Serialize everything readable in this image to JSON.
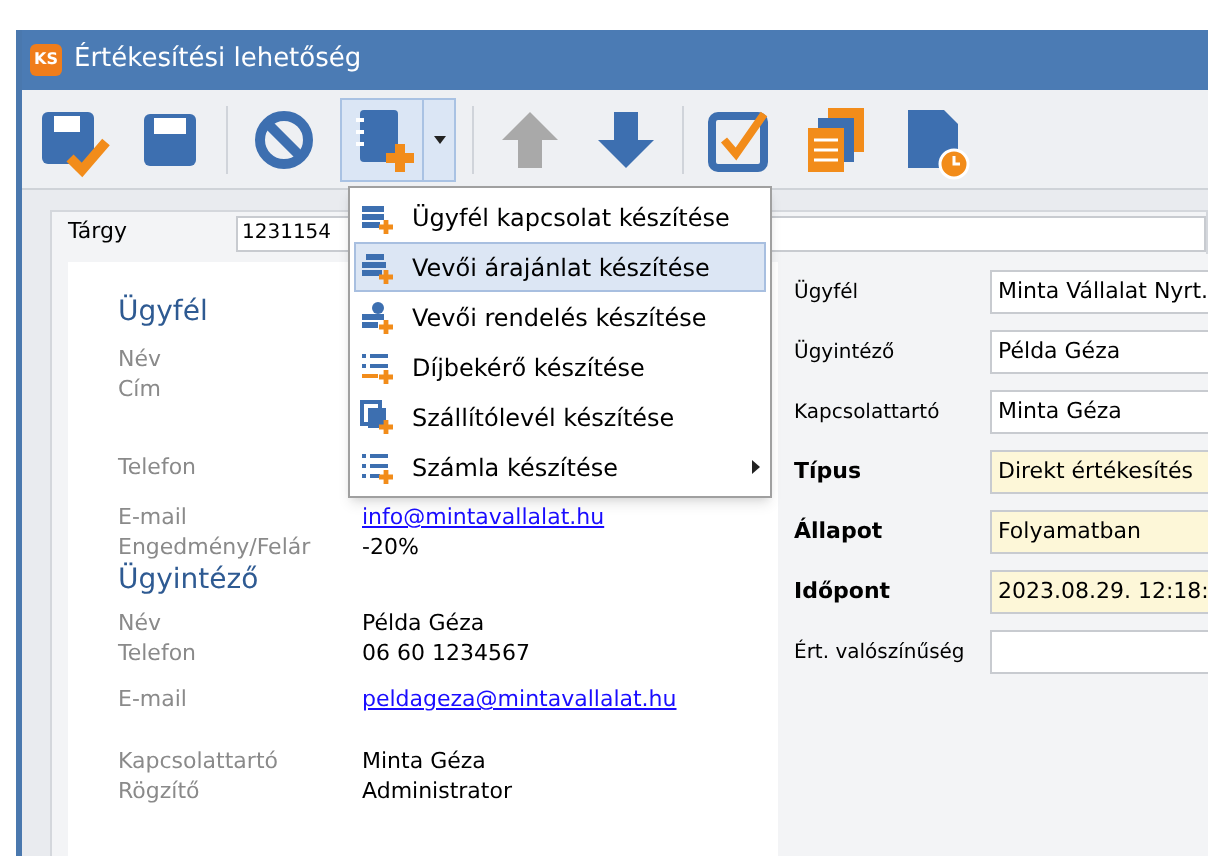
{
  "window": {
    "title": "Értékesítési lehetőség",
    "logo": "KS"
  },
  "toolbar": {
    "dropdown_open": true
  },
  "subject": {
    "label": "Tárgy",
    "value": "1231154"
  },
  "customer": {
    "heading": "Ügyfél",
    "rows": [
      {
        "label": "Név"
      },
      {
        "label": "Cím"
      },
      {
        "label": "Telefon"
      },
      {
        "label": "E-mail",
        "value": "info@mintavallalat.hu",
        "kind": "link"
      },
      {
        "label": "Engedmény/Felár",
        "value": "-20%",
        "kind": "text"
      }
    ]
  },
  "agent": {
    "heading": "Ügyintéző",
    "rows": [
      {
        "label": "Név",
        "value": "Példa Géza",
        "kind": "text"
      },
      {
        "label": "Telefon",
        "value": "06 60 1234567",
        "kind": "text"
      },
      {
        "label": "E-mail",
        "value": "peldageza@mintavallalat.hu",
        "kind": "link"
      },
      {
        "label": "Kapcsolattartó",
        "value": "Minta Géza",
        "kind": "text"
      },
      {
        "label": "Rögzítő",
        "value": "Administrator",
        "kind": "text"
      }
    ]
  },
  "form": [
    {
      "label": "Ügyfél",
      "value": "Minta Vállalat Nyrt.",
      "required": false
    },
    {
      "label": "Ügyintéző",
      "value": "Példa Géza",
      "required": false
    },
    {
      "label": "Kapcsolattartó",
      "value": "Minta Géza",
      "required": false
    },
    {
      "label": "Típus",
      "value": "Direkt értékesítés",
      "required": true
    },
    {
      "label": "Állapot",
      "value": "Folyamatban",
      "required": true
    },
    {
      "label": "Időpont",
      "value": "2023.08.29. 12:18:",
      "required": true
    },
    {
      "label": "Ért. valószínűség",
      "required": false
    }
  ],
  "menu": [
    {
      "label": "Ügyfél kapcsolat készítése",
      "selected": false,
      "submenu": false
    },
    {
      "label": "Vevői árajánlat készítése",
      "selected": true,
      "submenu": false
    },
    {
      "label": "Vevői rendelés készítése",
      "selected": false,
      "submenu": false
    },
    {
      "label": "Díjbekérő készítése",
      "selected": false,
      "submenu": false
    },
    {
      "label": "Szállítólevél készítése",
      "selected": false,
      "submenu": false
    },
    {
      "label": "Számla készítése",
      "selected": false,
      "submenu": true
    }
  ]
}
